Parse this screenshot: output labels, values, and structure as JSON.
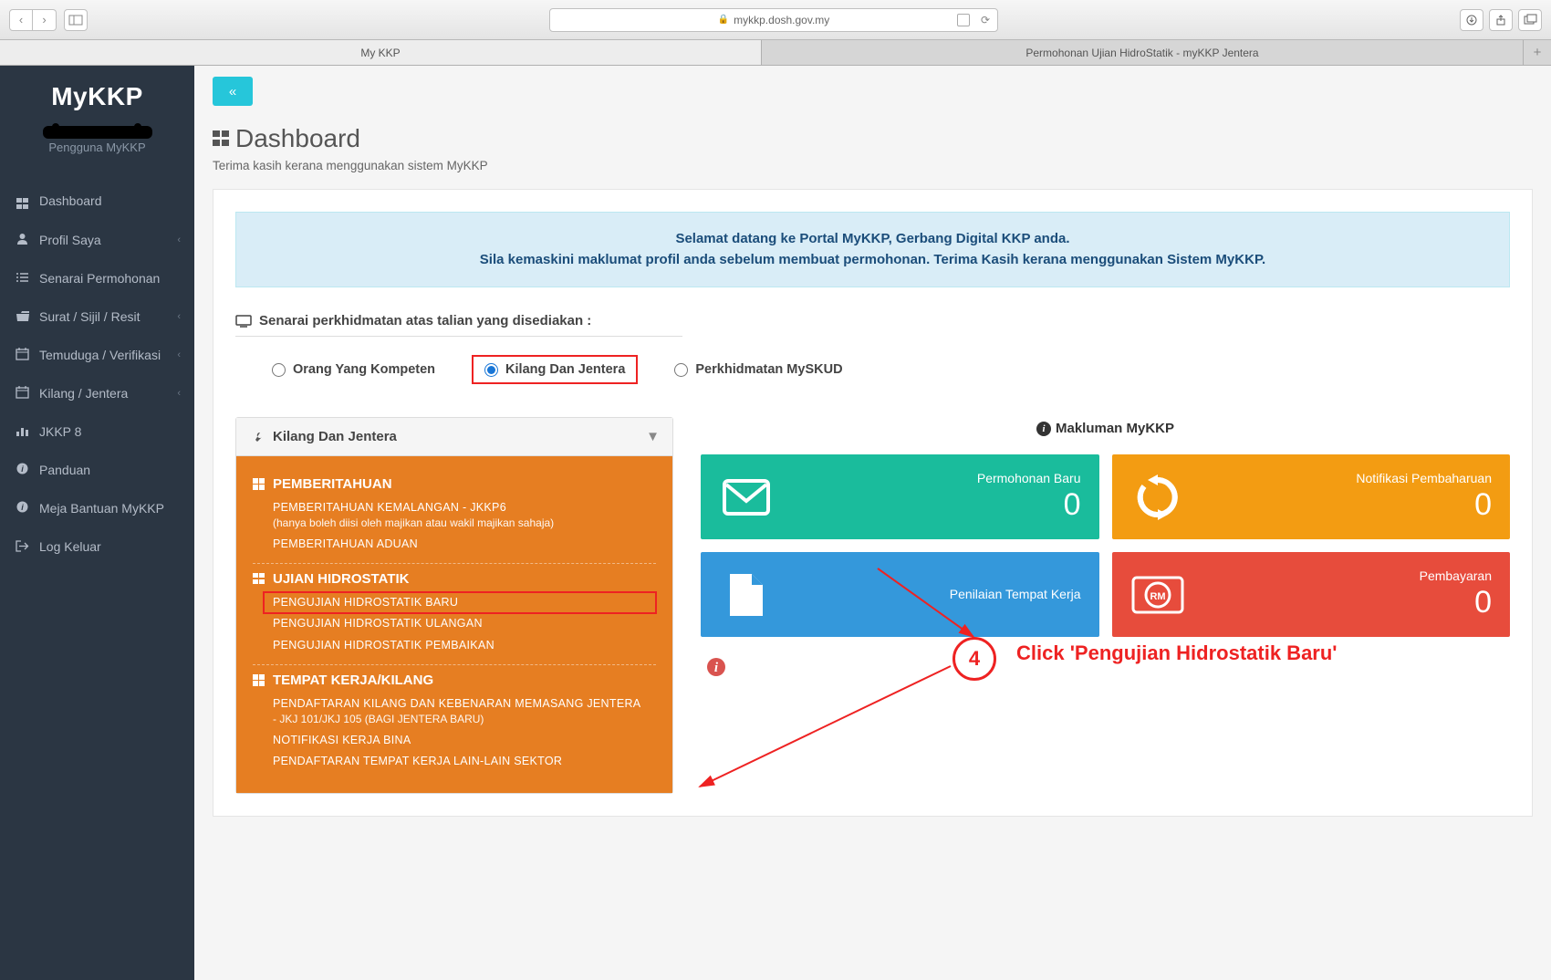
{
  "browser": {
    "url": "mykkp.dosh.gov.my",
    "tabs": [
      "My KKP",
      "Permohonan Ujian HidroStatik - myKKP Jentera"
    ]
  },
  "sidebar": {
    "brand": "MyKKP",
    "subtitle": "Pengguna MyKKP",
    "items": [
      {
        "icon": "grid",
        "label": "Dashboard",
        "chev": false
      },
      {
        "icon": "user",
        "label": "Profil Saya",
        "chev": true
      },
      {
        "icon": "list",
        "label": "Senarai Permohonan",
        "chev": false
      },
      {
        "icon": "folder",
        "label": "Surat / Sijil / Resit",
        "chev": true
      },
      {
        "icon": "calendar",
        "label": "Temuduga / Verifikasi",
        "chev": true
      },
      {
        "icon": "calendar",
        "label": "Kilang / Jentera",
        "chev": true
      },
      {
        "icon": "chart",
        "label": "JKKP 8",
        "chev": false
      },
      {
        "icon": "info",
        "label": "Panduan",
        "chev": false
      },
      {
        "icon": "info",
        "label": "Meja Bantuan MyKKP",
        "chev": false
      },
      {
        "icon": "logout",
        "label": "Log Keluar",
        "chev": false
      }
    ]
  },
  "header": {
    "title": "Dashboard",
    "subtitle": "Terima kasih kerana menggunakan sistem MyKKP"
  },
  "alert": {
    "line1": "Selamat datang ke Portal MyKKP, Gerbang Digital KKP anda.",
    "line2": "Sila kemaskini maklumat profil anda sebelum membuat permohonan. Terima Kasih kerana menggunakan Sistem MyKKP."
  },
  "services": {
    "heading": "Senarai perkhidmatan atas talian yang disediakan :",
    "options": [
      {
        "label": "Orang Yang Kompeten",
        "checked": false
      },
      {
        "label": "Kilang Dan Jentera",
        "checked": true,
        "highlight": true
      },
      {
        "label": "Perkhidmatan MySKUD",
        "checked": false
      }
    ]
  },
  "panel": {
    "title": "Kilang Dan Jentera",
    "sections": [
      {
        "title": "PEMBERITAHUAN",
        "items": [
          {
            "label": "PEMBERITAHUAN KEMALANGAN - JKKP6",
            "sub": "(hanya boleh diisi oleh majikan atau wakil majikan sahaja)"
          },
          {
            "label": "PEMBERITAHUAN ADUAN"
          }
        ]
      },
      {
        "title": "UJIAN HIDROSTATIK",
        "items": [
          {
            "label": "PENGUJIAN HIDROSTATIK BARU",
            "highlight": true
          },
          {
            "label": "PENGUJIAN HIDROSTATIK ULANGAN"
          },
          {
            "label": "PENGUJIAN HIDROSTATIK PEMBAIKAN"
          }
        ]
      },
      {
        "title": "TEMPAT KERJA/KILANG",
        "items": [
          {
            "label": "PENDAFTARAN KILANG DAN KEBENARAN MEMASANG JENTERA",
            "sub": "- JKJ 101/JKJ 105 (BAGI JENTERA BARU)"
          },
          {
            "label": "NOTIFIKASI KERJA BINA"
          },
          {
            "label": "PENDAFTARAN TEMPAT KERJA LAIN-LAIN SEKTOR"
          }
        ]
      }
    ]
  },
  "makluman": "Makluman MyKKP",
  "cards": [
    {
      "color": "c-teal",
      "icon": "mail",
      "label": "Permohonan Baru",
      "value": "0"
    },
    {
      "color": "c-orange",
      "icon": "refresh",
      "label": "Notifikasi Pembaharuan",
      "value": "0"
    },
    {
      "color": "c-blue",
      "icon": "file",
      "label": "Penilaian Tempat Kerja",
      "value": ""
    },
    {
      "color": "c-red",
      "icon": "rm",
      "label": "Pembayaran",
      "value": "0"
    }
  ],
  "annotation": {
    "num": "4",
    "text": "Click 'Pengujian Hidrostatik Baru'"
  }
}
